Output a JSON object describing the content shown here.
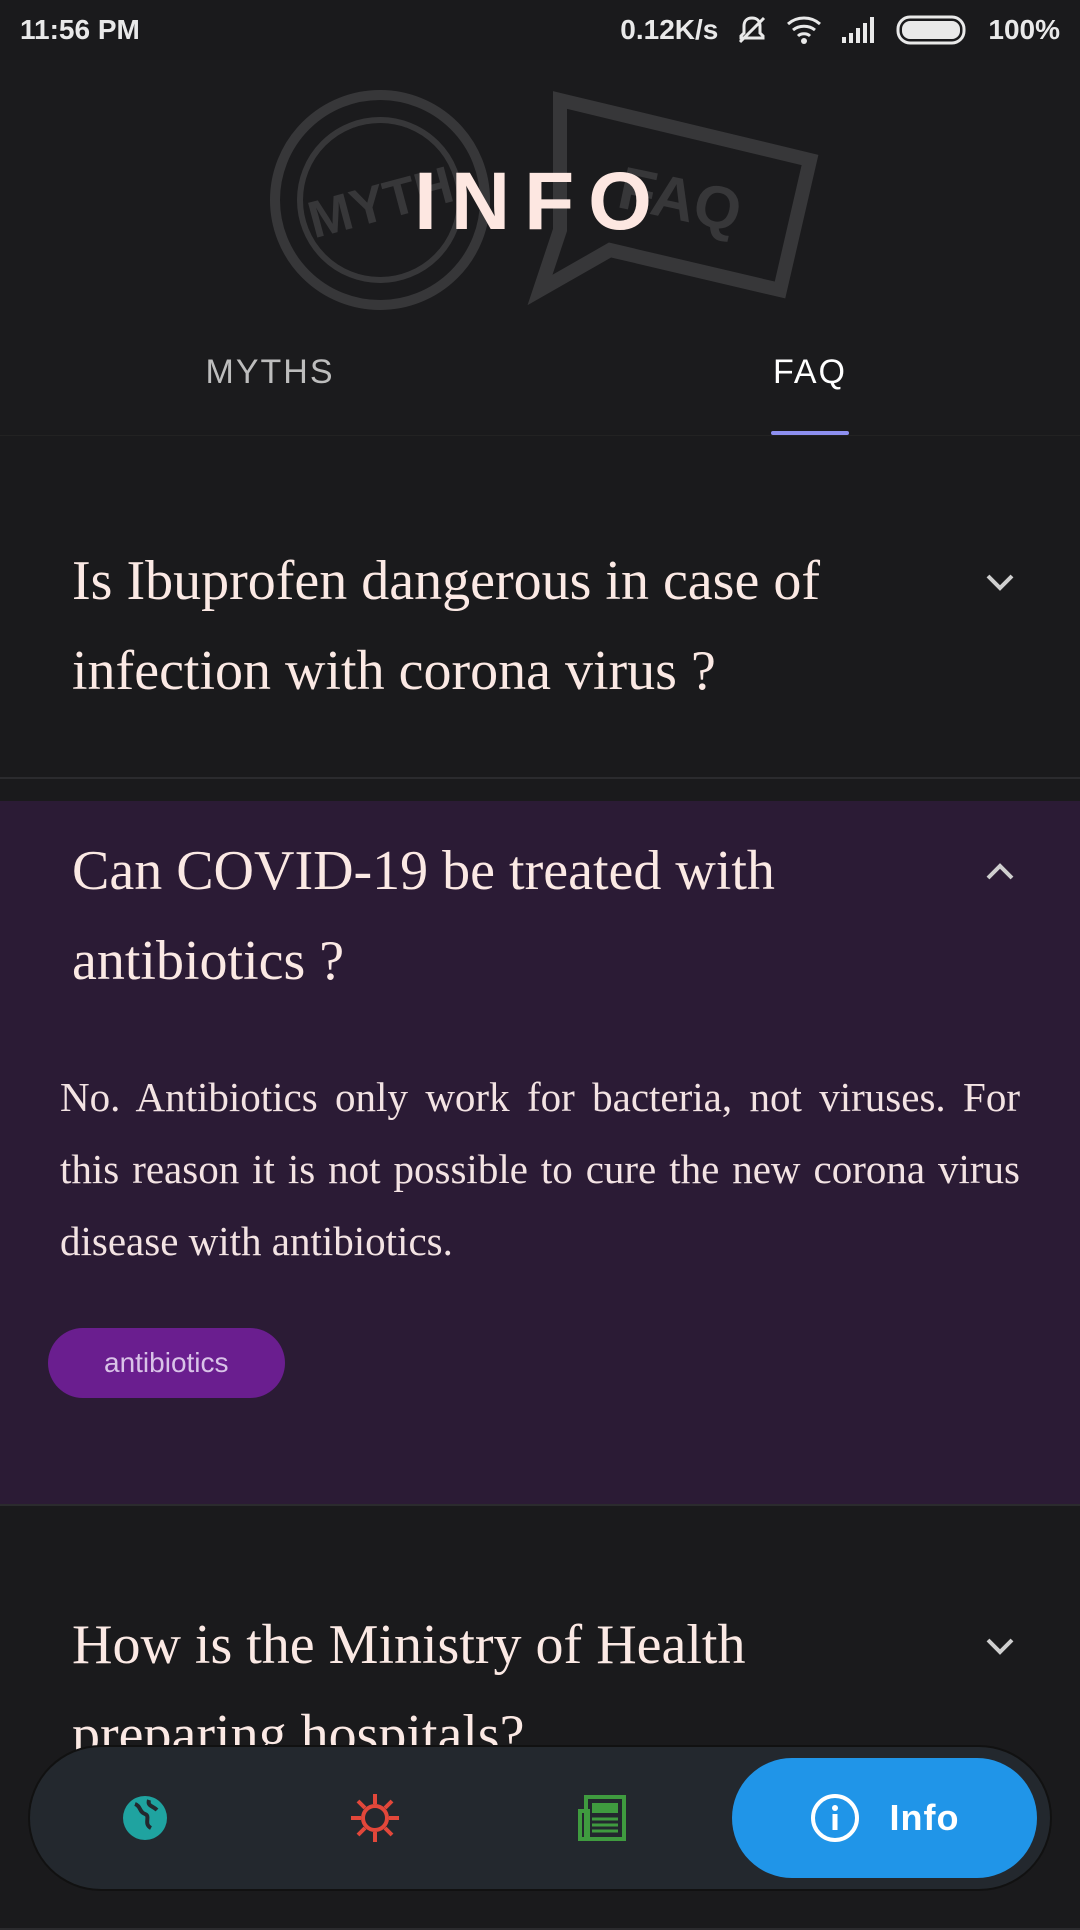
{
  "status_bar": {
    "time": "11:56 PM",
    "net_speed": "0.12K/s",
    "battery": "100%"
  },
  "header": {
    "title": "INFO",
    "bg_label_left": "MYTH",
    "bg_label_right": "FAQ"
  },
  "tabs": [
    {
      "label": "MYTHS",
      "active": false
    },
    {
      "label": "FAQ",
      "active": true
    }
  ],
  "faqs": [
    {
      "question": "Is Ibuprofen dangerous in case of infection with corona virus ?",
      "expanded": false
    },
    {
      "question": "Can COVID-19 be treated with antibiotics ?",
      "expanded": true,
      "answer": "No. Antibiotics only work for bacteria, not viruses. For this reason it is not possible to cure the new corona virus disease with antibiotics.",
      "tag": "antibiotics"
    },
    {
      "question": "How is the Ministry of Health preparing hospitals?",
      "expanded": false
    }
  ],
  "bottom_nav": {
    "items": [
      {
        "name": "globe-icon",
        "color": "#1fa3a0"
      },
      {
        "name": "virus-icon",
        "color": "#e2473a"
      },
      {
        "name": "newspaper-icon",
        "color": "#3f9b3f"
      }
    ],
    "active_label": "Info",
    "active_color": "#2095e8"
  }
}
